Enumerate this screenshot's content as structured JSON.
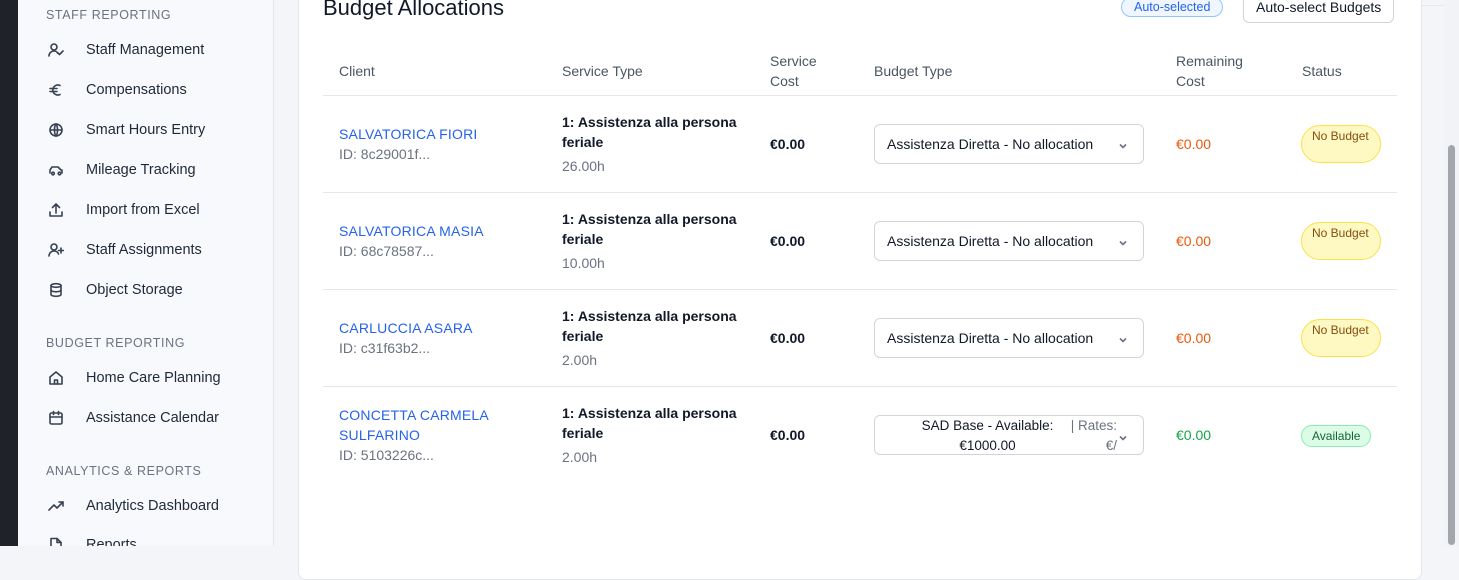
{
  "sidebar": {
    "sections": [
      {
        "title": "STAFF REPORTING",
        "items": [
          {
            "label": "Staff Management",
            "icon": "user-check-icon"
          },
          {
            "label": "Compensations",
            "icon": "euro-icon"
          },
          {
            "label": "Smart Hours Entry",
            "icon": "globe-icon"
          },
          {
            "label": "Mileage Tracking",
            "icon": "car-icon"
          },
          {
            "label": "Import from Excel",
            "icon": "upload-icon"
          },
          {
            "label": "Staff Assignments",
            "icon": "user-plus-icon"
          },
          {
            "label": "Object Storage",
            "icon": "database-icon"
          }
        ]
      },
      {
        "title": "BUDGET REPORTING",
        "items": [
          {
            "label": "Home Care Planning",
            "icon": "home-icon"
          },
          {
            "label": "Assistance Calendar",
            "icon": "calendar-icon"
          }
        ]
      },
      {
        "title": "ANALYTICS & REPORTS",
        "items": [
          {
            "label": "Analytics Dashboard",
            "icon": "trending-up-icon"
          },
          {
            "label": "Reports",
            "icon": "file-icon"
          }
        ]
      }
    ]
  },
  "card": {
    "title": "Budget Allocations",
    "auto_selected_badge": "Auto-selected",
    "auto_select_button": "Auto-select Budgets"
  },
  "table": {
    "headers": {
      "client": "Client",
      "service_type": "Service Type",
      "service_cost": "Service Cost",
      "budget_type": "Budget Type",
      "remaining_cost": "Remaining Cost",
      "status": "Status"
    },
    "rows": [
      {
        "client": "SALVATORICA FIORI",
        "client_id": "ID: 8c29001f...",
        "service": "1: Assistenza alla persona feriale",
        "hours": "26.00h",
        "cost": "€0.00",
        "budget": "Assistenza Diretta - No allocation",
        "remaining": "€0.00",
        "status": "No Budget"
      },
      {
        "client": "SALVATORICA MASIA",
        "client_id": "ID: 68c78587...",
        "service": "1: Assistenza alla persona feriale",
        "hours": "10.00h",
        "cost": "€0.00",
        "budget": "Assistenza Diretta - No allocation",
        "remaining": "€0.00",
        "status": "No Budget"
      },
      {
        "client": "CARLUCCIA ASARA",
        "client_id": "ID: c31f63b2...",
        "service": "1: Assistenza alla persona feriale",
        "hours": "2.00h",
        "cost": "€0.00",
        "budget": "Assistenza Diretta - No allocation",
        "remaining": "€0.00",
        "status": "No Budget"
      },
      {
        "client": "CONCETTA CARMELA SULFARINO",
        "client_id": "ID: 5103226c...",
        "service": "1: Assistenza alla persona feriale",
        "hours": "2.00h",
        "cost": "€0.00",
        "budget_line1": "SAD Base - Available: €1000.00",
        "budget_line2": "| Rates: €/",
        "remaining": "€0.00",
        "status": "Available"
      }
    ]
  },
  "colors": {
    "link": "#2563eb",
    "remaining_negative": "#ea580c",
    "remaining_positive": "#16a34a"
  }
}
